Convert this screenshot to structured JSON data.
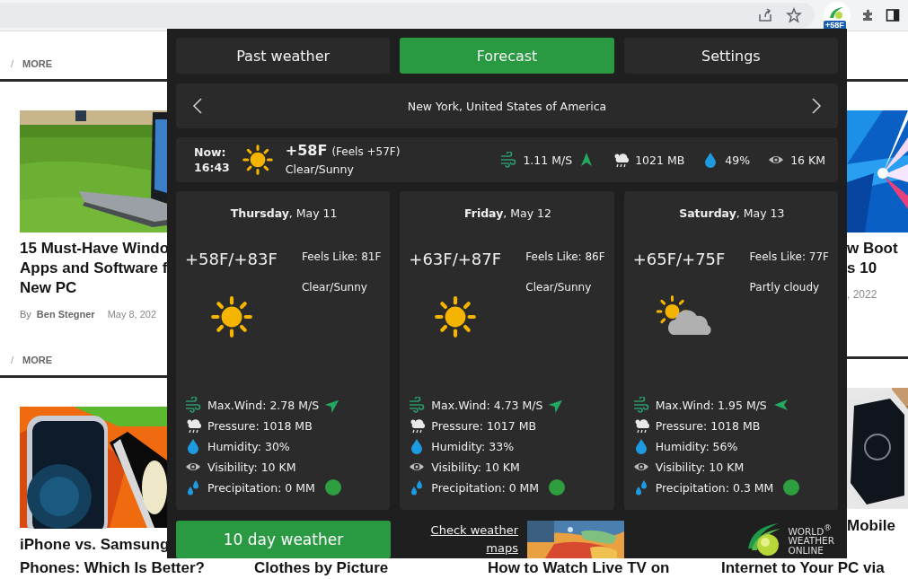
{
  "browser": {
    "extension_badge": "+58F"
  },
  "left_column": [
    {
      "kind": "more",
      "separator": "/",
      "label": "MORE"
    },
    {
      "kind": "article",
      "title_lines": [
        "15 Must-Have Windo",
        "Apps and Software f",
        "New PC"
      ],
      "byline": {
        "by": "By",
        "author": "Ben Stegner",
        "date": "May 8, 202"
      }
    },
    {
      "kind": "more",
      "separator": "/",
      "label": "MORE"
    },
    {
      "kind": "article",
      "title_lines": [
        "iPhone vs. Samsung"
      ]
    }
  ],
  "right_column": [
    {
      "kind": "more"
    },
    {
      "kind": "article",
      "title_lines": [
        "w Boot",
        "s 10"
      ],
      "date": ", 2022"
    },
    {
      "kind": "more"
    },
    {
      "kind": "article",
      "title_lines": [
        "Mobile"
      ]
    }
  ],
  "bottom_titles": [
    "Phones: Which Is Better?",
    "Clothes by Picture",
    "How to Watch Live TV on",
    "Internet to Your PC via"
  ],
  "popup": {
    "tabs": [
      {
        "label": "Past weather",
        "selected": false
      },
      {
        "label": "Forecast",
        "selected": true
      },
      {
        "label": "Settings",
        "selected": false
      }
    ],
    "location": "New York, United States of America",
    "now": {
      "label": "Now:",
      "time": "16:43",
      "kind": "sunny",
      "temp": "+58F",
      "feels": "(Feels +57F)",
      "condition": "Clear/Sunny",
      "wind": "1.11 M/S",
      "wind_arrow": {
        "kind": "north"
      },
      "pressure": "1021 MB",
      "humidity": "49%",
      "visibility": "16 KM"
    },
    "days": [
      {
        "title": "**Thursday**, May 11",
        "temp": "+58F/+83F",
        "feels": "Feels Like: 81F",
        "condition": "Clear/Sunny",
        "kind": "sunny",
        "wind": "Max.Wind: 2.78 M/S",
        "wind_arrow": {
          "kind": "northeast"
        },
        "pressure": "Pressure: 1018 MB",
        "humidity": "Humidity: 30%",
        "visibility": "Visibility: 10 KM",
        "precipitation": "Precipitation: 0 MM"
      },
      {
        "title": "**Friday**, May 12",
        "temp": "+63F/+87F",
        "feels": "Feels Like: 86F",
        "condition": "Clear/Sunny",
        "kind": "sunny",
        "wind": "Max.Wind: 4.73 M/S",
        "wind_arrow": {
          "kind": "northeast"
        },
        "pressure": "Pressure: 1017 MB",
        "humidity": "Humidity: 33%",
        "visibility": "Visibility: 10 KM",
        "precipitation": "Precipitation: 0 MM"
      },
      {
        "title": "**Saturday**, May 13",
        "temp": "+65F/+75F",
        "feels": "Feels Like: 77F",
        "condition": "Partly cloudy",
        "kind": "partly_cloudy",
        "wind": "Max.Wind: 1.95 M/S",
        "wind_arrow": {
          "kind": "west"
        },
        "pressure": "Pressure: 1018 MB",
        "humidity": "Humidity: 56%",
        "visibility": "Visibility: 10 KM",
        "precipitation": "Precipitation: 0.3 MM"
      }
    ],
    "footer": {
      "button": "10 day weather",
      "maps_link": "Check weather maps",
      "map_preview": {
        "kind": "picture"
      },
      "logo_lines": [
        "WORLD$^{®}$",
        "WEATHER",
        "ONLINE"
      ]
    }
  }
}
